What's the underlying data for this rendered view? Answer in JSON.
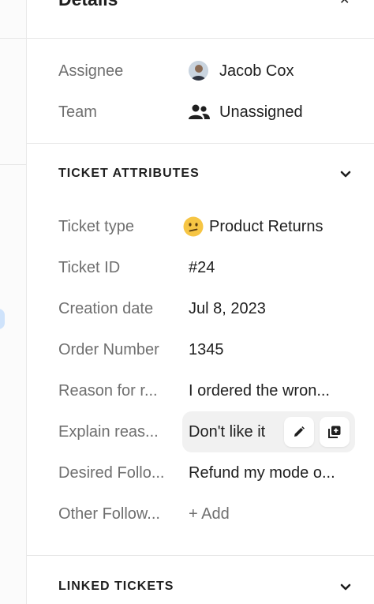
{
  "panel": {
    "title": "Details"
  },
  "details": {
    "assignee": {
      "label": "Assignee",
      "value": "Jacob Cox"
    },
    "team": {
      "label": "Team",
      "value": "Unassigned"
    }
  },
  "ticket_attributes": {
    "heading": "TICKET ATTRIBUTES",
    "rows": [
      {
        "label": "Ticket type",
        "value": "Product Returns",
        "icon": "confused-face-icon"
      },
      {
        "label": "Ticket ID",
        "value": "#24"
      },
      {
        "label": "Creation date",
        "value": "Jul 8, 2023"
      },
      {
        "label": "Order Number",
        "value": "1345"
      },
      {
        "label": "Reason for r...",
        "value": "I ordered the wron..."
      },
      {
        "label": "Explain reas...",
        "value": "Don't like it"
      },
      {
        "label": "Desired Follo...",
        "value": "Refund my mode o..."
      },
      {
        "label": "Other Follow...",
        "value": "+ Add"
      }
    ]
  },
  "linked_tickets": {
    "heading": "LINKED TICKETS"
  },
  "colors": {
    "label": "#6f6f6f",
    "text": "#1f1f1f",
    "divider": "#e6e6e6",
    "hover_bg": "#f1f1f1"
  }
}
